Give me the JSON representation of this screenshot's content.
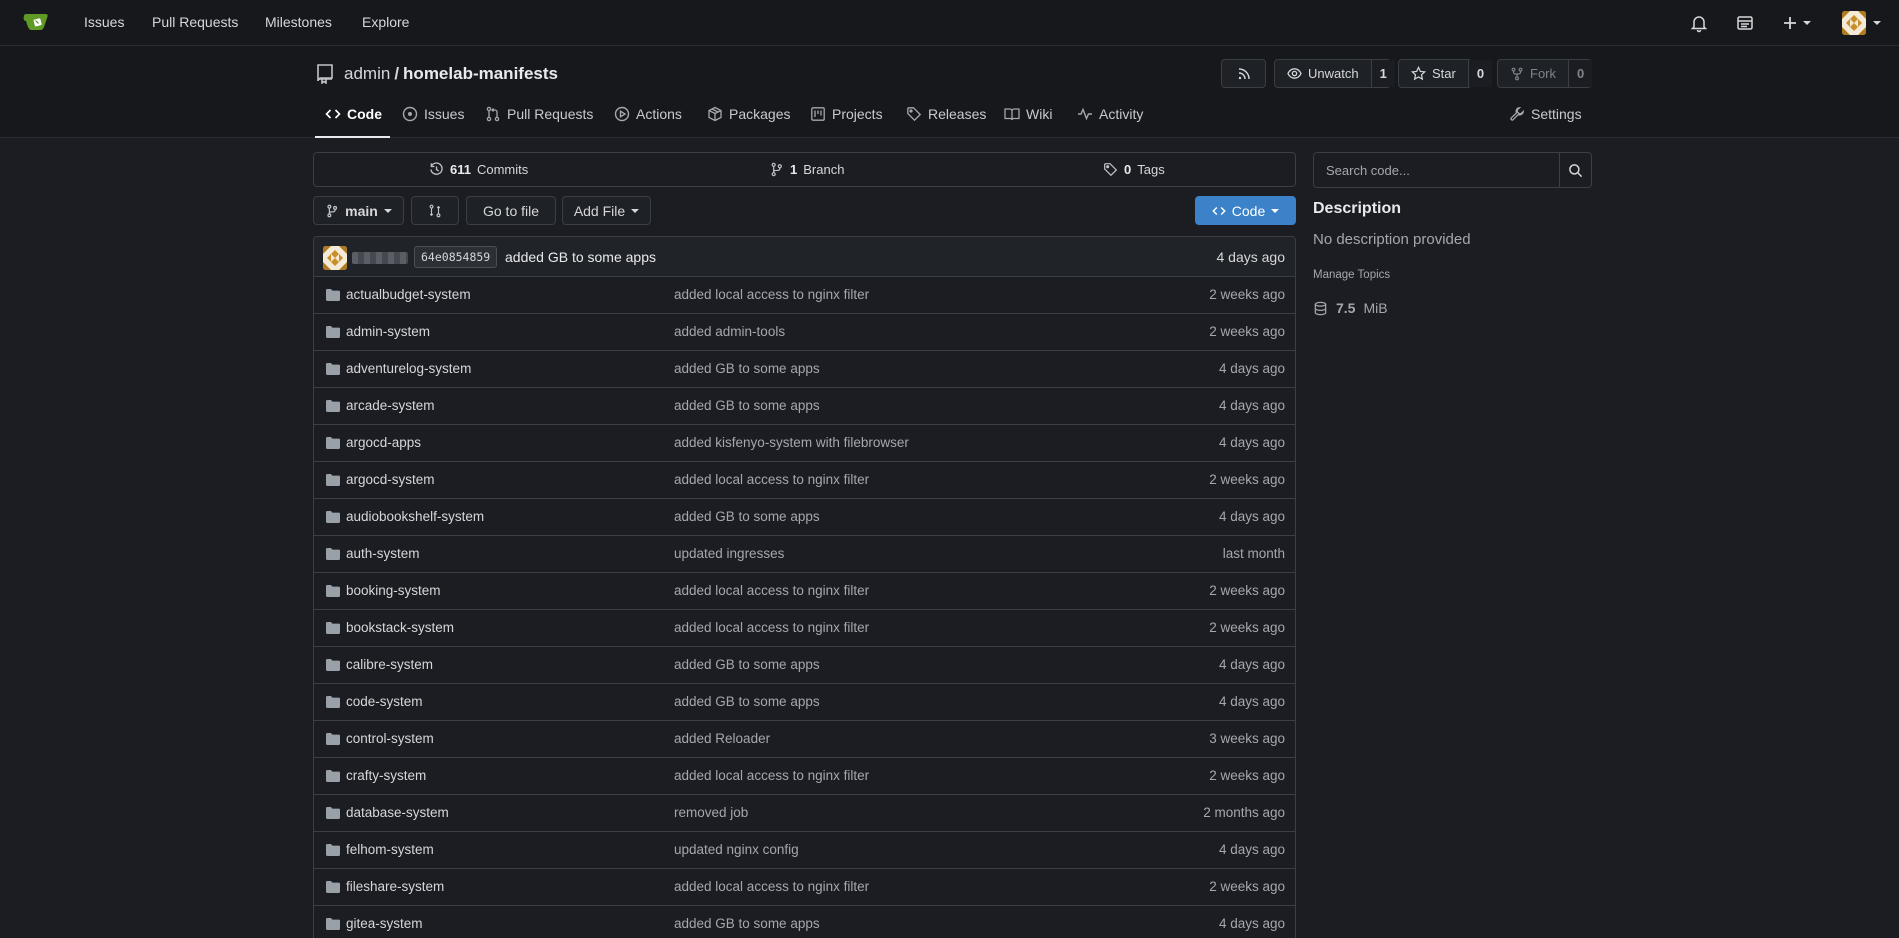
{
  "topnav": {
    "links": [
      "Issues",
      "Pull Requests",
      "Milestones",
      "Explore"
    ],
    "logo_icon": "gitea-teacup-icon",
    "right_icons": [
      "bell-icon",
      "dashboard-icon",
      "plus-icon",
      "avatar"
    ]
  },
  "repo": {
    "owner": "admin",
    "separator": "/",
    "name": "homelab-manifests",
    "rss_icon": "rss-icon",
    "watch_label": "Unwatch",
    "watch_count": "1",
    "star_label": "Star",
    "star_count": "0",
    "fork_label": "Fork",
    "fork_count": "0"
  },
  "tabs": [
    {
      "label": "Code",
      "icon": "code-icon",
      "active": true
    },
    {
      "label": "Issues",
      "icon": "issue-icon"
    },
    {
      "label": "Pull Requests",
      "icon": "pull-request-icon"
    },
    {
      "label": "Actions",
      "icon": "play-icon"
    },
    {
      "label": "Packages",
      "icon": "package-icon"
    },
    {
      "label": "Projects",
      "icon": "project-icon"
    },
    {
      "label": "Releases",
      "icon": "tag-icon"
    },
    {
      "label": "Wiki",
      "icon": "book-icon"
    },
    {
      "label": "Activity",
      "icon": "pulse-icon"
    },
    {
      "label": "Settings",
      "icon": "tools-icon"
    }
  ],
  "stats": {
    "commits_count": "611",
    "commits_label": "Commits",
    "branch_count": "1",
    "branch_label": "Branch",
    "tags_count": "0",
    "tags_label": "Tags"
  },
  "toolbar": {
    "branch": "main",
    "go_to_file": "Go to file",
    "add_file": "Add File",
    "code_button": "Code"
  },
  "latest_commit": {
    "sha": "64e0854859",
    "message": "added GB to some apps",
    "age": "4 days ago"
  },
  "files": [
    {
      "name": "actualbudget-system",
      "message": "added local access to nginx filter",
      "age": "2 weeks ago"
    },
    {
      "name": "admin-system",
      "message": "added admin-tools",
      "age": "2 weeks ago"
    },
    {
      "name": "adventurelog-system",
      "message": "added GB to some apps",
      "age": "4 days ago"
    },
    {
      "name": "arcade-system",
      "message": "added GB to some apps",
      "age": "4 days ago"
    },
    {
      "name": "argocd-apps",
      "message": "added kisfenyo-system with filebrowser",
      "age": "4 days ago"
    },
    {
      "name": "argocd-system",
      "message": "added local access to nginx filter",
      "age": "2 weeks ago"
    },
    {
      "name": "audiobookshelf-system",
      "message": "added GB to some apps",
      "age": "4 days ago"
    },
    {
      "name": "auth-system",
      "message": "updated ingresses",
      "age": "last month"
    },
    {
      "name": "booking-system",
      "message": "added local access to nginx filter",
      "age": "2 weeks ago"
    },
    {
      "name": "bookstack-system",
      "message": "added local access to nginx filter",
      "age": "2 weeks ago"
    },
    {
      "name": "calibre-system",
      "message": "added GB to some apps",
      "age": "4 days ago"
    },
    {
      "name": "code-system",
      "message": "added GB to some apps",
      "age": "4 days ago"
    },
    {
      "name": "control-system",
      "message": "added Reloader",
      "age": "3 weeks ago"
    },
    {
      "name": "crafty-system",
      "message": "added local access to nginx filter",
      "age": "2 weeks ago"
    },
    {
      "name": "database-system",
      "message": "removed job",
      "age": "2 months ago"
    },
    {
      "name": "felhom-system",
      "message": "updated nginx config",
      "age": "4 days ago"
    },
    {
      "name": "fileshare-system",
      "message": "added local access to nginx filter",
      "age": "2 weeks ago"
    },
    {
      "name": "gitea-system",
      "message": "added GB to some apps",
      "age": "4 days ago"
    }
  ],
  "sidebar": {
    "search_placeholder": "Search code...",
    "description_heading": "Description",
    "description_text": "No description provided",
    "manage_topics": "Manage Topics",
    "size_value": "7.5",
    "size_unit": "MiB"
  },
  "colors": {
    "background": "#1b1d22",
    "header": "#16181c",
    "border": "#3a3e45",
    "primary_button": "#3b82c8",
    "logo_green": "#609926"
  }
}
